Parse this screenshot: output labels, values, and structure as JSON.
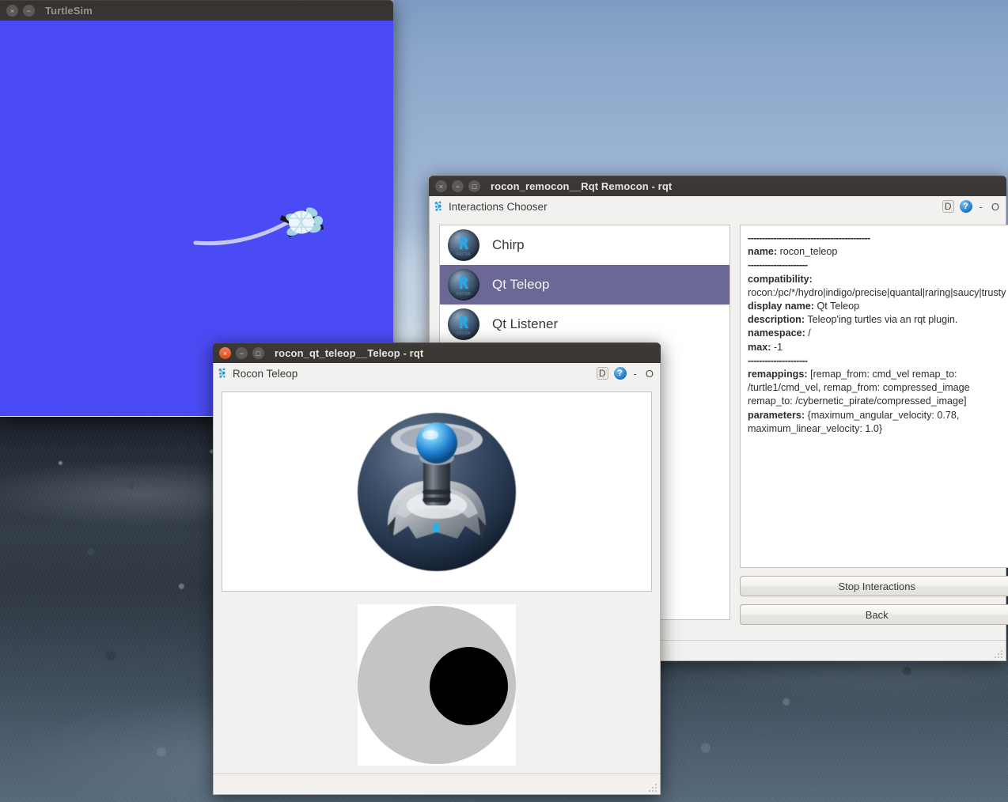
{
  "desktop": {
    "wallpaper_description": "pebble beach under cloudy sky"
  },
  "turtlesim": {
    "title": "TurtleSim",
    "window_buttons": {
      "close": "×",
      "minimize": "−"
    },
    "canvas_bg": "#4b4bf5",
    "turtle": {
      "trail_color": "#c9c9f2",
      "shell_color": "#e8f4fb",
      "fin_color": "#9ed6e2"
    }
  },
  "remocon": {
    "title": "rocon_remocon__Rqt Remocon - rqt",
    "window_buttons": {
      "close": "×",
      "minimize": "−",
      "maximize": "□"
    },
    "plugin": {
      "icon": "ros-logo-icon",
      "title": "Interactions Chooser",
      "actions": {
        "dock": "D",
        "help": "?",
        "minimize": "-",
        "close": "O"
      }
    },
    "interactions": [
      {
        "label": "Chirp",
        "icon": "rocon-app-icon",
        "selected": false
      },
      {
        "label": "Qt Teleop",
        "icon": "rocon-app-icon",
        "selected": true
      },
      {
        "label": "Qt Listener",
        "icon": "rocon-app-icon",
        "selected": false
      }
    ],
    "details": {
      "rule_long": "-------------------------------------------",
      "rule_short": "---------------------",
      "rows": [
        {
          "key": "name:",
          "value": " rocon_teleop"
        },
        {
          "key": "compatibility:",
          "value": " rocon:/pc/*/hydro|indigo/precise|quantal|raring|saucy|trusty"
        },
        {
          "key": "display name:",
          "value": " Qt Teleop"
        },
        {
          "key": "description:",
          "value": " Teleop'ing turtles via an rqt plugin."
        },
        {
          "key": "namespace:",
          "value": " /"
        },
        {
          "key": "max:",
          "value": " -1"
        },
        {
          "key": "remappings:",
          "value": " [remap_from: cmd_vel remap_to: /turtle1/cmd_vel, remap_from: compressed_image remap_to: /cybernetic_pirate/compressed_image]"
        },
        {
          "key": "parameters:",
          "value": " {maximum_angular_velocity: 0.78, maximum_linear_velocity: 1.0}"
        }
      ]
    },
    "buttons": {
      "stop": "Stop Interactions",
      "back": "Back"
    }
  },
  "teleop": {
    "title": "rocon_qt_teleop__Teleop - rqt",
    "window_buttons": {
      "close": "×",
      "minimize": "−",
      "maximize": "□"
    },
    "plugin": {
      "icon": "ros-logo-icon",
      "title": "Rocon Teleop",
      "actions": {
        "dock": "D",
        "help": "?",
        "minimize": "-",
        "close": "O"
      }
    },
    "image": {
      "name": "joystick-image"
    },
    "pad": {
      "name": "teleop-direction-pad",
      "outer_color": "#c4c4c4",
      "cursor_color": "#000000"
    }
  }
}
